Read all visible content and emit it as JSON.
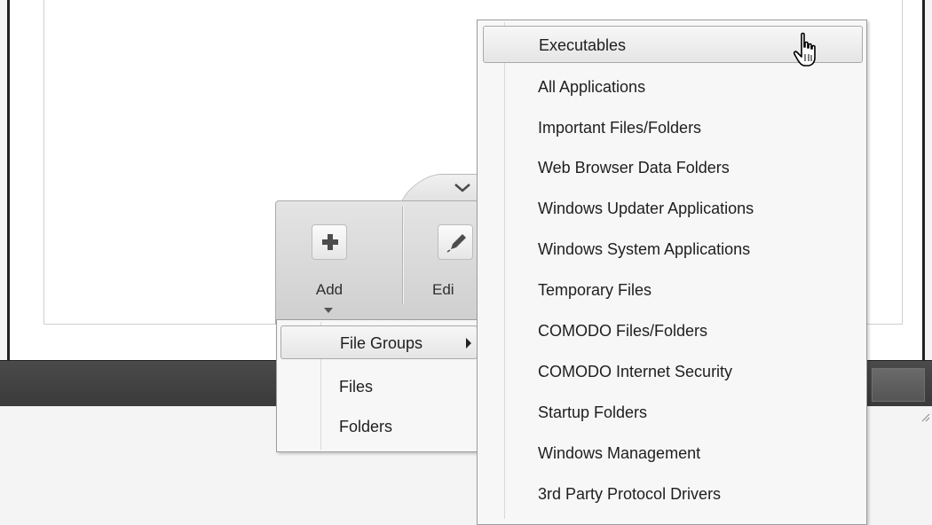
{
  "toolbar": {
    "add_label": "Add",
    "edit_label": "Edi"
  },
  "add_menu": {
    "items": [
      {
        "label": "File Groups",
        "highlighted": true,
        "has_submenu": true
      },
      {
        "label": "Files"
      },
      {
        "label": "Folders"
      }
    ]
  },
  "file_groups_menu": {
    "items": [
      {
        "label": "Executables",
        "highlighted": true
      },
      {
        "label": "All Applications"
      },
      {
        "label": "Important Files/Folders"
      },
      {
        "label": "Web Browser Data Folders"
      },
      {
        "label": "Windows Updater Applications"
      },
      {
        "label": "Windows System Applications"
      },
      {
        "label": "Temporary Files"
      },
      {
        "label": "COMODO Files/Folders"
      },
      {
        "label": "COMODO Internet Security"
      },
      {
        "label": "Startup Folders"
      },
      {
        "label": "Windows Management"
      },
      {
        "label": "3rd Party Protocol Drivers"
      }
    ]
  },
  "icons": {
    "add": "plus-icon",
    "edit": "pencil-icon",
    "cursor": "hand-pointer-icon",
    "toolbar_toggle": "chevron-down-icon",
    "submenu": "triangle-right-icon",
    "dropdown": "triangle-down-icon"
  },
  "colors": {
    "bottom_bar": "#3f3f3f",
    "menu_background": "#f7f7f7",
    "toolbar_background": "#d9d9d9"
  }
}
